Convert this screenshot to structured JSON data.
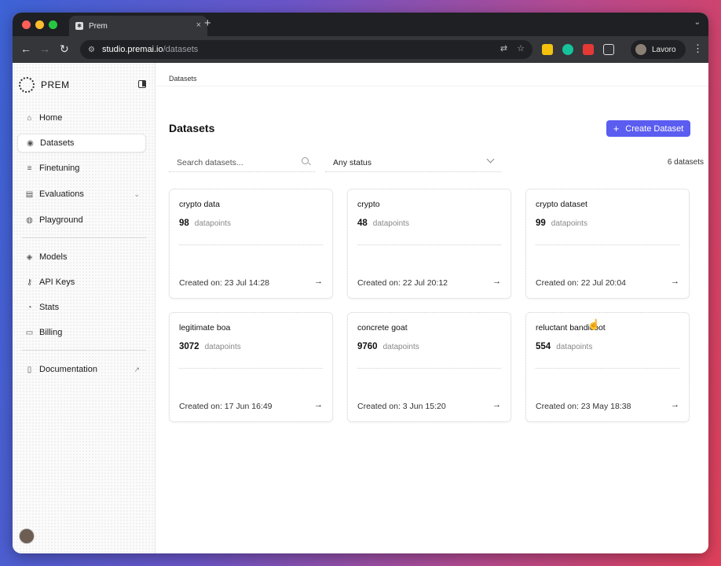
{
  "browser": {
    "tab_title": "Prem",
    "tab_close": "×",
    "new_tab": "+",
    "url_host": "studio.premai.io",
    "url_path": "/datasets",
    "profile_name": "Lavoro",
    "traffic_lights": [
      "#ff5f57",
      "#febc2e",
      "#28c840"
    ]
  },
  "sidebar": {
    "logo_text": "PREM",
    "group1": [
      {
        "label": "Home",
        "icon": "home-icon"
      },
      {
        "label": "Datasets",
        "icon": "database-icon",
        "active": true
      },
      {
        "label": "Finetuning",
        "icon": "sliders-icon"
      },
      {
        "label": "Evaluations",
        "icon": "clipboard-icon",
        "extra": "⌄"
      },
      {
        "label": "Playground",
        "icon": "chat-icon"
      }
    ],
    "group2": [
      {
        "label": "Models",
        "icon": "cube-icon"
      },
      {
        "label": "API Keys",
        "icon": "key-icon"
      },
      {
        "label": "Stats",
        "icon": "stats-icon"
      },
      {
        "label": "Billing",
        "icon": "billing-icon"
      }
    ],
    "group3": [
      {
        "label": "Documentation",
        "icon": "document-icon",
        "extra": "↗"
      }
    ]
  },
  "main": {
    "breadcrumb": "Datasets",
    "title": "Datasets",
    "create_button": "Create Dataset",
    "search_placeholder": "Search datasets...",
    "status_filter": "Any status",
    "count": "6 datasets",
    "datapoints_label": "datapoints",
    "cards": [
      {
        "name": "crypto data",
        "value": "98",
        "created": "Created on: 23 Jul 14:28"
      },
      {
        "name": "crypto",
        "value": "48",
        "created": "Created on: 22 Jul 20:12"
      },
      {
        "name": "crypto dataset",
        "value": "99",
        "created": "Created on: 22 Jul 20:04"
      },
      {
        "name": "legitimate boa",
        "value": "3072",
        "created": "Created on: 17 Jun 16:49"
      },
      {
        "name": "concrete goat",
        "value": "9760",
        "created": "Created on: 3 Jun 15:20"
      },
      {
        "name": "reluctant bandicoot",
        "value": "554",
        "created": "Created on: 23 May 18:38"
      }
    ]
  },
  "accent_color": "#5b5cf0"
}
